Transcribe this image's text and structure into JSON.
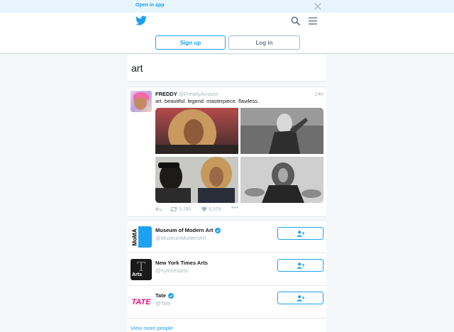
{
  "banner": {
    "open_in_app": "Open in app"
  },
  "header": {
    "signup_label": "Sign up",
    "login_label": "Log in"
  },
  "search": {
    "query": "art"
  },
  "tweet": {
    "name": "FREDDY",
    "handle": "@FreddyAmazin",
    "time": "24h",
    "text": "art. beautiful. legend. masterpiece. flawless.",
    "retweets": "5,780",
    "likes": "9,378"
  },
  "people": [
    {
      "name": "Museum of Modern Art",
      "handle": "@MuseumModernArt",
      "verified": true,
      "avatar_text": "MoMA"
    },
    {
      "name": "New York Times Arts",
      "handle": "@nytimesarts",
      "verified": false,
      "avatar_text": "Arts"
    },
    {
      "name": "Tate",
      "handle": "@Tate",
      "verified": true,
      "avatar_text": "TATE"
    }
  ],
  "view_more": "View more people",
  "colors": {
    "accent": "#1da1f2",
    "muted": "#aab8c2",
    "background": "#f5f8fa"
  }
}
